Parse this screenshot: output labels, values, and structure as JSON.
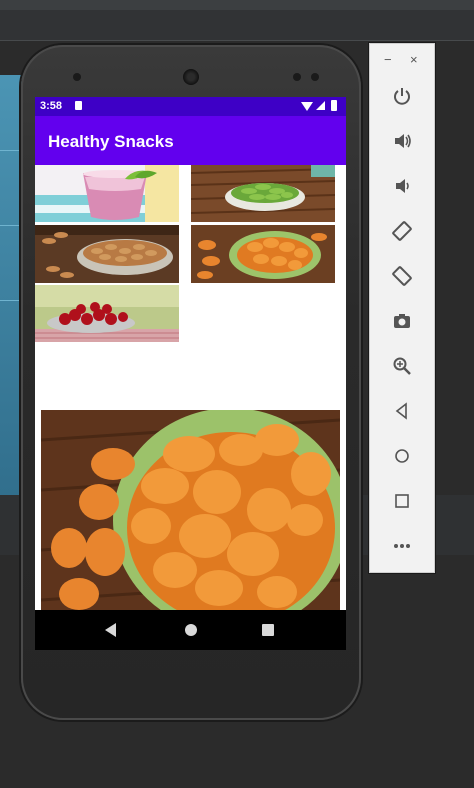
{
  "status_bar": {
    "time": "3:58"
  },
  "app": {
    "title": "Healthy Snacks"
  },
  "gallery": {
    "thumbnails": [
      {
        "name": "smoothie-thumbnail",
        "subject": "berry smoothie"
      },
      {
        "name": "edamame-thumbnail",
        "subject": "edamame"
      },
      {
        "name": "almonds-thumbnail",
        "subject": "almonds"
      },
      {
        "name": "apricots-thumbnail",
        "subject": "dried apricots"
      },
      {
        "name": "cherries-thumbnail",
        "subject": "cherries"
      }
    ],
    "selected": "dried apricots"
  },
  "emulator_toolbar": {
    "window_controls": [
      "−",
      "×"
    ],
    "buttons": [
      "power-icon",
      "volume-up-icon",
      "volume-down-icon",
      "rotate-left-icon",
      "rotate-right-icon",
      "camera-icon",
      "zoom-icon",
      "back-icon",
      "home-icon",
      "overview-icon",
      "more-icon"
    ]
  },
  "colors": {
    "status_bar": "#3e00c6",
    "app_bar": "#6200ee",
    "emulator_panel": "#f2f2f2"
  }
}
